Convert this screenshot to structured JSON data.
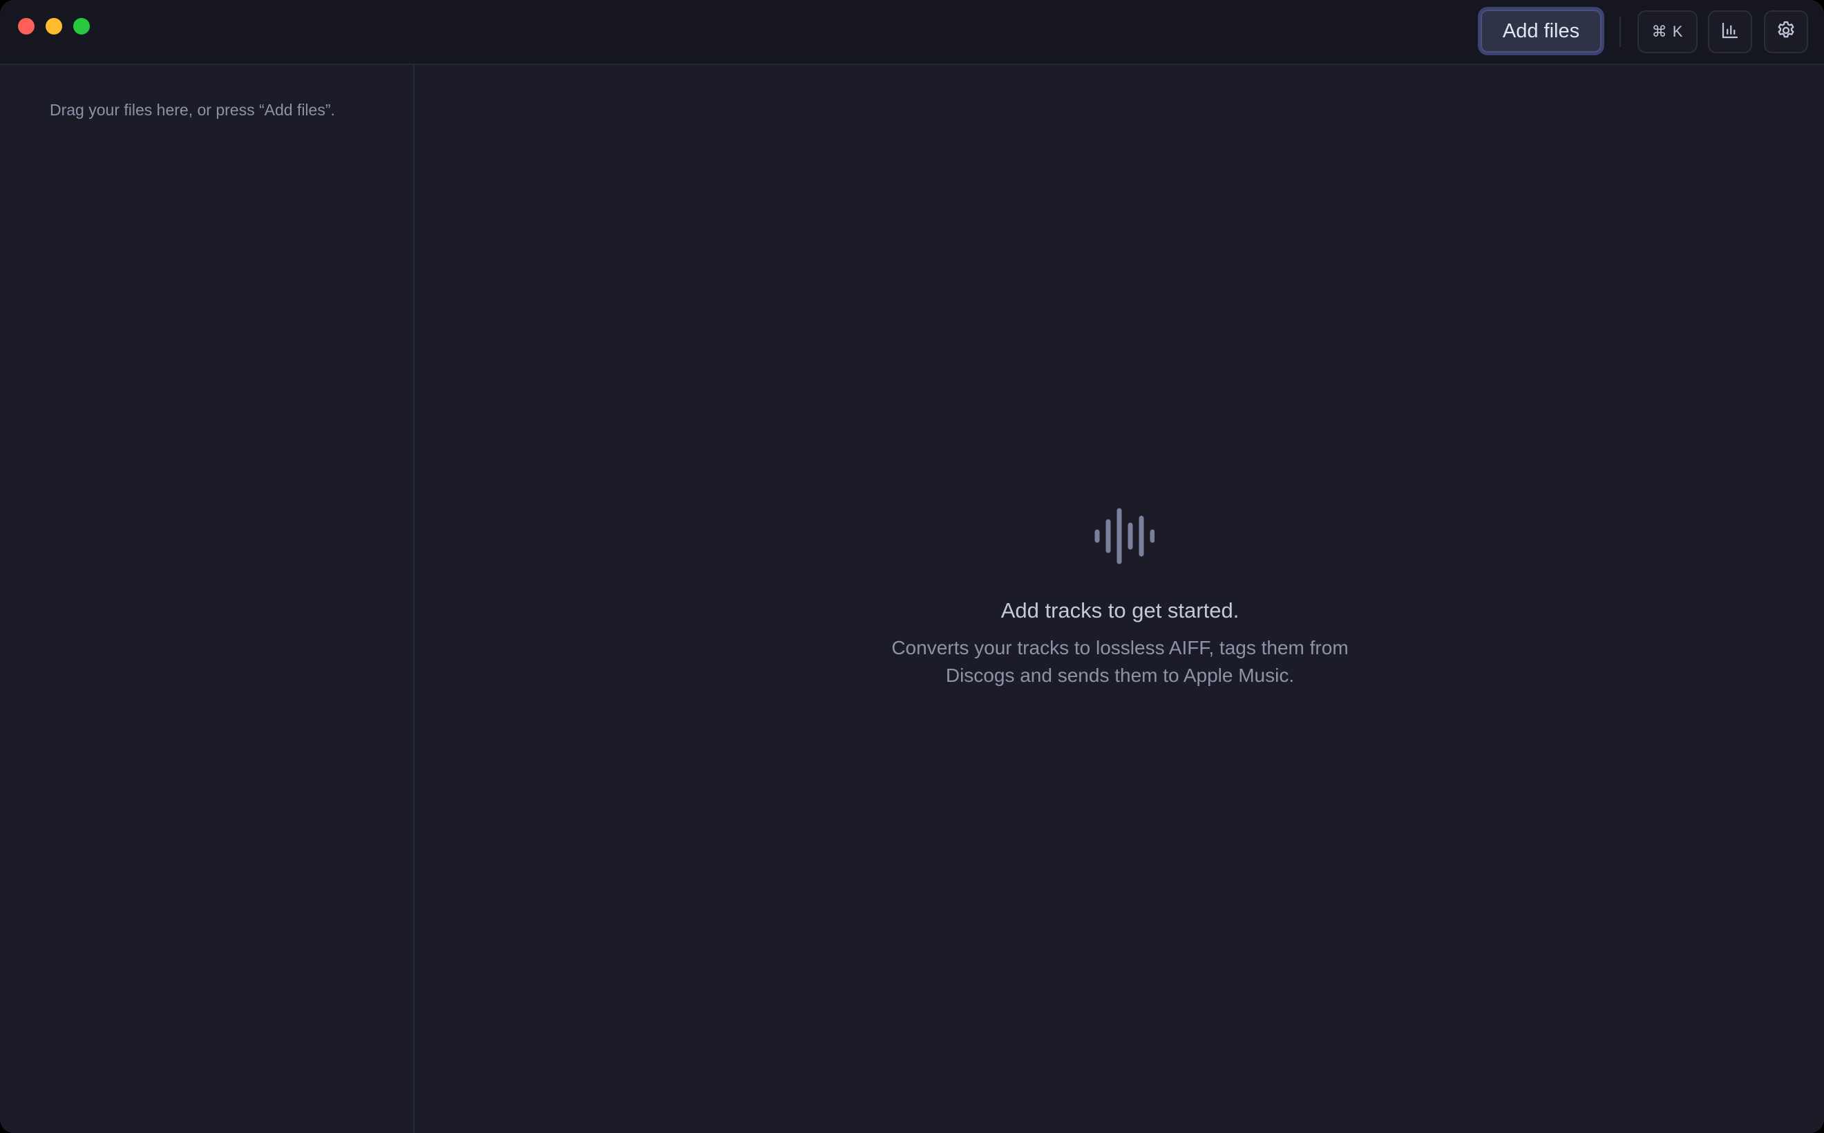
{
  "titlebar": {
    "add_files_label": "Add files",
    "shortcut_label": "⌘ K",
    "icons": [
      "chart-icon",
      "gear-icon"
    ]
  },
  "sidebar": {
    "hint": "Drag your files here, or press “Add files”."
  },
  "empty_state": {
    "icon": "waveform-icon",
    "title": "Add tracks to get started.",
    "subtitle": "Converts your tracks to lossless AIFF, tags them from Discogs and sends them to Apple Music."
  },
  "colors": {
    "background": "#1b1c27",
    "titlebar": "#15161f",
    "accent_border": "#3a4272",
    "icon": "#7a7f9c"
  }
}
